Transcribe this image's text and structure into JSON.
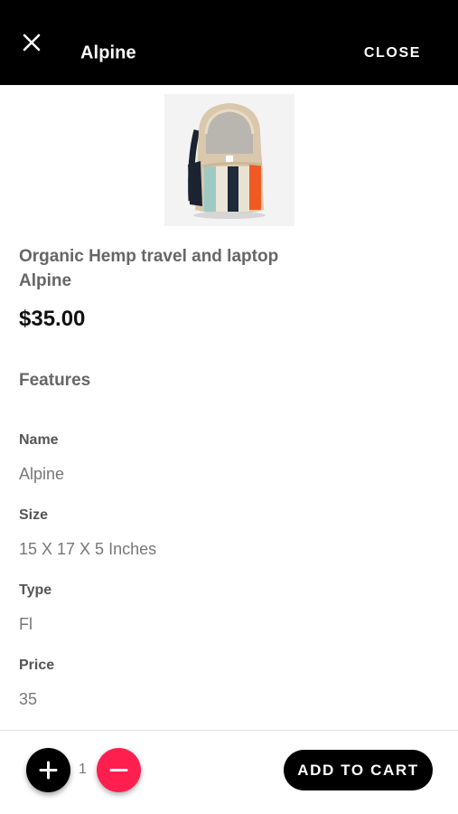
{
  "header": {
    "title": "Alpine",
    "close_label": "CLOSE",
    "background": "#000000",
    "icon": "close-x-icon"
  },
  "product": {
    "name": "Organic Hemp travel and laptop Alpine",
    "price": "$35.00",
    "image": "backpack-image"
  },
  "features": {
    "heading": "Features",
    "items": [
      {
        "label": "Name",
        "value": "Alpine"
      },
      {
        "label": "Size",
        "value": "15 X 17 X 5 Inches"
      },
      {
        "label": "Type",
        "value": "Fl"
      },
      {
        "label": "Price",
        "value": "35"
      }
    ]
  },
  "cart_bar": {
    "quantity": "1",
    "add_to_cart_label": "ADD TO CART",
    "plus_icon": "plus-icon",
    "minus_icon": "minus-icon",
    "plus_color": "#000000",
    "minus_color": "#ff1f4f"
  }
}
